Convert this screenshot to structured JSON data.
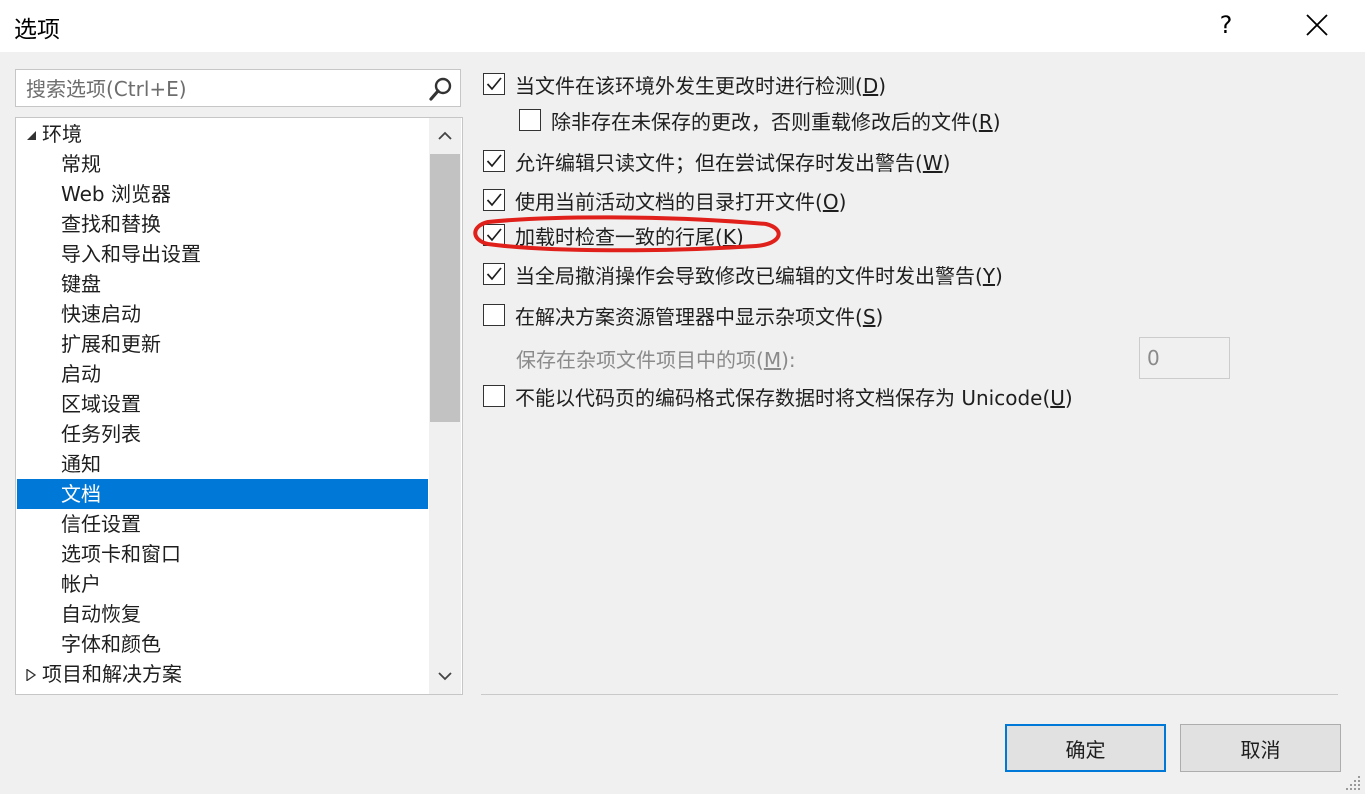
{
  "window": {
    "title": "选项",
    "help_label": "?"
  },
  "search": {
    "placeholder": "搜索选项(Ctrl+E)"
  },
  "tree": {
    "items": [
      {
        "label": "环境",
        "level": 0,
        "expanded": true
      },
      {
        "label": "常规",
        "level": 1
      },
      {
        "label": "Web 浏览器",
        "level": 1
      },
      {
        "label": "查找和替换",
        "level": 1
      },
      {
        "label": "导入和导出设置",
        "level": 1
      },
      {
        "label": "键盘",
        "level": 1
      },
      {
        "label": "快速启动",
        "level": 1
      },
      {
        "label": "扩展和更新",
        "level": 1
      },
      {
        "label": "启动",
        "level": 1
      },
      {
        "label": "区域设置",
        "level": 1
      },
      {
        "label": "任务列表",
        "level": 1
      },
      {
        "label": "通知",
        "level": 1
      },
      {
        "label": "文档",
        "level": 1,
        "selected": true
      },
      {
        "label": "信任设置",
        "level": 1
      },
      {
        "label": "选项卡和窗口",
        "level": 1
      },
      {
        "label": "帐户",
        "level": 1
      },
      {
        "label": "自动恢复",
        "level": 1
      },
      {
        "label": "字体和颜色",
        "level": 1
      },
      {
        "label": "项目和解决方案",
        "level": 0,
        "expanded": false
      }
    ]
  },
  "options": {
    "detect_changes": {
      "text": "当文件在该环境外发生更改时进行检测(",
      "key": "D",
      "end": ")",
      "checked": true
    },
    "reload_unless_unsaved": {
      "text": "除非存在未保存的更改，否则重载修改后的文件(",
      "key": "R",
      "end": ")",
      "checked": false
    },
    "allow_edit_readonly": {
      "text": "允许编辑只读文件；但在尝试保存时发出警告(",
      "key": "W",
      "end": ")",
      "checked": true
    },
    "open_in_active_dir": {
      "text": "使用当前活动文档的目录打开文件(",
      "key": "O",
      "end": ")",
      "checked": true
    },
    "check_line_endings": {
      "text": "加载时检查一致的行尾(",
      "key": "K",
      "end": ")",
      "checked": true
    },
    "warn_global_undo": {
      "text": "当全局撤消操作会导致修改已编辑的文件时发出警告(",
      "key": "Y",
      "end": ")",
      "checked": true
    },
    "show_misc_files": {
      "text": "在解决方案资源管理器中显示杂项文件(",
      "key": "S",
      "end": ")",
      "checked": false
    },
    "misc_items": {
      "text": "保存在杂项文件项目中的项(",
      "key": "M",
      "end": "):",
      "value": "0"
    },
    "save_as_unicode": {
      "text": "不能以代码页的编码格式保存数据时将文档保存为 Unicode(",
      "key": "U",
      "end": ")",
      "checked": false
    }
  },
  "buttons": {
    "ok": "确定",
    "cancel": "取消"
  },
  "colors": {
    "selection": "#0078d7",
    "annotation": "#e0201b"
  }
}
